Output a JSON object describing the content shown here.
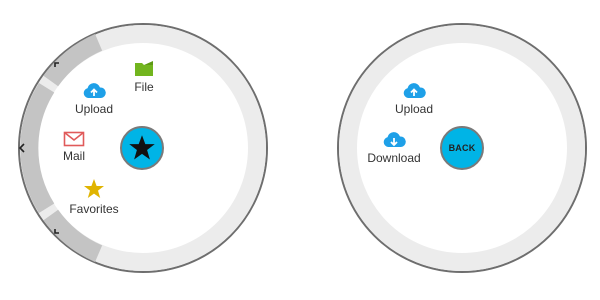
{
  "colors": {
    "ring": "#ececec",
    "ring_border": "#6e6e6e",
    "segment": "#c4c4c4",
    "accent": "#00b4e6",
    "cloud": "#1ea0e8",
    "folder": "#72b51e",
    "mail": "#e05a5a",
    "star": "#e0b400"
  },
  "left_menu": {
    "items": [
      {
        "label": "Upload",
        "icon": "cloud-upload-icon"
      },
      {
        "label": "File",
        "icon": "folder-icon"
      },
      {
        "label": "Mail",
        "icon": "mail-icon"
      },
      {
        "label": "Favorites",
        "icon": "star-icon"
      }
    ],
    "center_icon": "star-icon",
    "segment_icons": [
      "corner-expand-icon",
      "chevron-left-icon",
      "corner-collapse-icon"
    ]
  },
  "right_menu": {
    "items": [
      {
        "label": "Upload",
        "icon": "cloud-upload-icon"
      },
      {
        "label": "Download",
        "icon": "cloud-download-icon"
      }
    ],
    "center_label": "BACK"
  }
}
